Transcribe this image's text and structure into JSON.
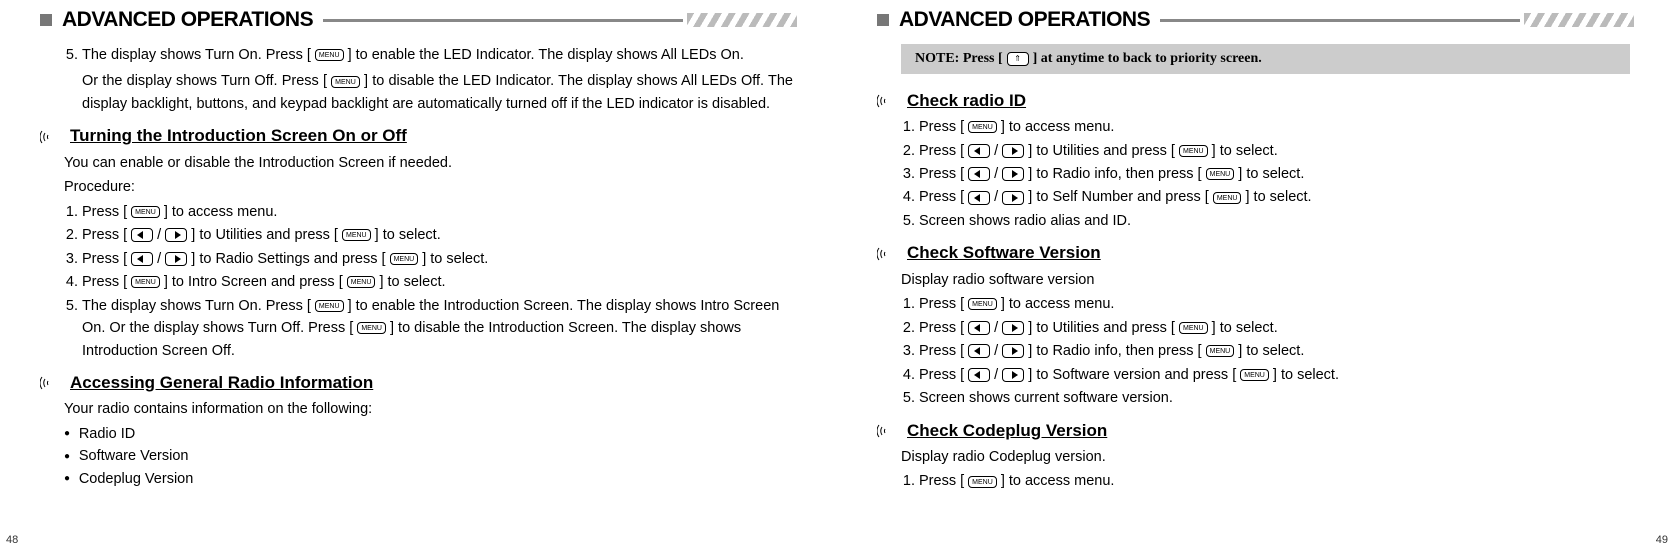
{
  "left": {
    "headerTitle": "ADVANCED OPERATIONS",
    "step5a": "The display shows Turn On. Press [",
    "step5b": "] to enable the LED Indicator. The display shows All LEDs On.",
    "step5c": "Or the display shows Turn Off. Press [",
    "step5d": "] to disable the LED Indicator. The display shows All LEDs Off. The display backlight, buttons, and keypad backlight are automatically turned off if the LED indicator is disabled.",
    "subIntro": "Turning the Introduction Screen On or Off",
    "introPara1": "You can enable or disable the  Introduction Screen if needed.",
    "introPara2": "Procedure:",
    "introStep1a": "Press [",
    "introStep1b": "] to access menu.",
    "introStep2a": "Press [",
    "introStep2b": "] to Utilities and press [",
    "introStep2c": "] to select.",
    "introStep3a": "Press [",
    "introStep3b": "] to Radio Settings and press [",
    "introStep3c": "] to select.",
    "introStep4a": "Press [",
    "introStep4b": "] to Intro Screen and press [",
    "introStep4c": "] to select.",
    "introStep5a": "The display shows Turn On. Press [",
    "introStep5b": "] to enable the Introduction Screen. The display shows Intro Screen On. Or the display shows Turn Off. Press [",
    "introStep5c": "] to disable the Introduction Screen. The display shows Introduction Screen Off.",
    "subGeneral": "Accessing General Radio Information",
    "genPara": "Your radio contains information on the following:",
    "bullet1": "Radio ID",
    "bullet2": "Software Version",
    "bullet3": "Codeplug Version",
    "pageNum": "48"
  },
  "right": {
    "headerTitle": "ADVANCED OPERATIONS",
    "noteA": "NOTE: Press  [",
    "noteB": "] at anytime to back to priority screen.",
    "subRadioId": "Check radio ID",
    "rid1a": "Press [",
    "rid1b": "] to access menu.",
    "rid2a": "Press [",
    "rid2b": "] to Utilities and press [",
    "rid2c": "] to select.",
    "rid3a": "Press [",
    "rid3b": "] to Radio info, then press [",
    "rid3c": "] to select.",
    "rid4a": "Press [",
    "rid4b": "] to Self Number and press [",
    "rid4c": "] to select.",
    "rid5": "Screen shows radio alias and ID.",
    "subSoft": "Check Software Version",
    "softPara": "Display radio software version",
    "soft1a": "Press [",
    "soft1b": "] to access menu.",
    "soft2a": "Press [",
    "soft2b": "] to Utilities and press [",
    "soft2c": "] to select.",
    "soft3a": "Press [",
    "soft3b": "] to Radio info, then press [",
    "soft3c": "] to select.",
    "soft4a": "Press [",
    "soft4b": "] to Software version and press [",
    "soft4c": "] to select.",
    "soft5": "Screen shows current software version.",
    "subCode": "Check Codeplug Version",
    "codePara": "Display radio Codeplug version.",
    "code1a": "Press [",
    "code1b": "] to access menu.",
    "pageNum": "49",
    "menuLabel": "MENU"
  }
}
